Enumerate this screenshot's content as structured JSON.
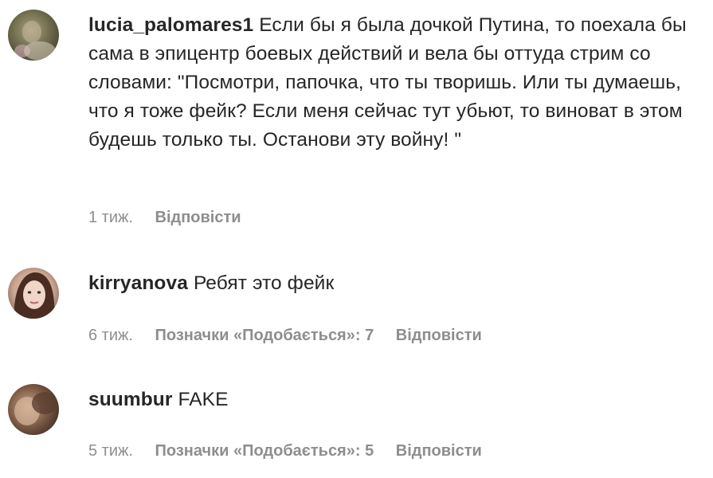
{
  "comments": [
    {
      "username": "lucia_palomares1",
      "text": "Если бы я была дочкой Путина, то поехала бы сама в эпицентр боевых действий и вела бы оттуда стрим со словами: \"Посмотри, папочка, что ты творишь. Или ты думаешь, что я тоже фейк? Если меня сейчас тут убьют, то виноват в этом будешь только ты. Останови эту войну! \"",
      "time": "1 тиж.",
      "reply": "Відповісти",
      "avatar_icon": "user-avatar-photo"
    },
    {
      "username": "kirryanova",
      "text": "Ребят это фейк",
      "time": "6 тиж.",
      "likes": "Позначки «Подобається»: 7",
      "reply": "Відповісти",
      "avatar_icon": "user-avatar-photo"
    },
    {
      "username": "suumbur",
      "text": "FAKE",
      "time": "5 тиж.",
      "likes": "Позначки «Подобається»: 5",
      "reply": "Відповісти",
      "avatar_icon": "user-avatar-photo"
    }
  ]
}
